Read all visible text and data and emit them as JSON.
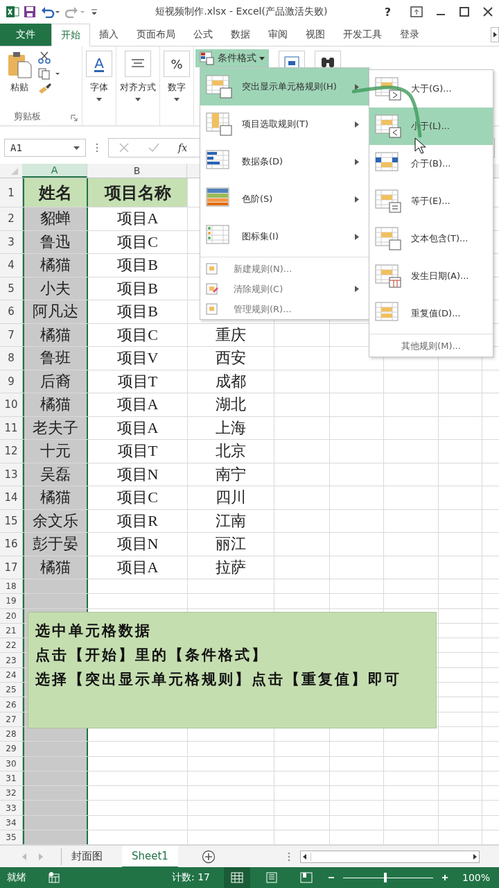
{
  "title_bar": {
    "title": "短视频制作.xlsx - Excel(产品激活失败)",
    "help": "?"
  },
  "file_tab": "文件",
  "ribbon_tabs": [
    {
      "label": "开始",
      "selected": true
    },
    {
      "label": "插入",
      "selected": false
    },
    {
      "label": "页面布局",
      "selected": false
    },
    {
      "label": "公式",
      "selected": false
    },
    {
      "label": "数据",
      "selected": false
    },
    {
      "label": "审阅",
      "selected": false
    },
    {
      "label": "视图",
      "selected": false
    },
    {
      "label": "开发工具",
      "selected": false
    },
    {
      "label": "登录",
      "selected": false
    }
  ],
  "ribbon": {
    "paste": "粘贴",
    "clipboard_group": "剪贴板",
    "buttons": [
      {
        "kind": "font",
        "glyph": "A",
        "label": "字体"
      },
      {
        "kind": "align",
        "label": "对齐方式"
      },
      {
        "kind": "number",
        "glyph": "%",
        "label": "数字"
      }
    ],
    "conditional_format": {
      "label": "条件格式",
      "selected": true
    }
  },
  "formula_bar": {
    "name_box": "A1",
    "fx": "fx"
  },
  "column_headers": [
    {
      "label": "A",
      "selected": true
    },
    {
      "label": "B",
      "selected": false
    }
  ],
  "rows": [
    {
      "num": "1",
      "cells": [
        "姓名",
        "项目名称"
      ]
    },
    {
      "num": "2",
      "cells": [
        "貂蝉",
        "项目A"
      ]
    },
    {
      "num": "3",
      "cells": [
        "鲁迅",
        "项目C"
      ]
    },
    {
      "num": "4",
      "cells": [
        "橘猫",
        "项目B"
      ]
    },
    {
      "num": "5",
      "cells": [
        "小夫",
        "项目B"
      ]
    },
    {
      "num": "6",
      "cells": [
        "阿凡达",
        "项目B"
      ]
    },
    {
      "num": "7",
      "cells": [
        "橘猫",
        "项目C",
        "重庆"
      ]
    },
    {
      "num": "8",
      "cells": [
        "鲁班",
        "项目V",
        "西安"
      ]
    },
    {
      "num": "9",
      "cells": [
        "后裔",
        "项目T",
        "成都"
      ]
    },
    {
      "num": "10",
      "cells": [
        "橘猫",
        "项目A",
        "湖北"
      ]
    },
    {
      "num": "11",
      "cells": [
        "老夫子",
        "项目A",
        "上海"
      ]
    },
    {
      "num": "12",
      "cells": [
        "十元",
        "项目T",
        "北京"
      ]
    },
    {
      "num": "13",
      "cells": [
        "吴磊",
        "项目N",
        "南宁"
      ]
    },
    {
      "num": "14",
      "cells": [
        "橘猫",
        "项目C",
        "四川"
      ]
    },
    {
      "num": "15",
      "cells": [
        "余文乐",
        "项目R",
        "江南"
      ]
    },
    {
      "num": "16",
      "cells": [
        "彭于晏",
        "项目N",
        "丽江"
      ]
    },
    {
      "num": "17",
      "cells": [
        "橘猫",
        "项目A",
        "拉萨"
      ]
    },
    {
      "num": "18",
      "cells": []
    },
    {
      "num": "19",
      "cells": []
    },
    {
      "num": "20",
      "cells": []
    },
    {
      "num": "21",
      "cells": []
    },
    {
      "num": "22",
      "cells": []
    },
    {
      "num": "23",
      "cells": []
    },
    {
      "num": "24",
      "cells": []
    },
    {
      "num": "25",
      "cells": []
    },
    {
      "num": "26",
      "cells": []
    },
    {
      "num": "27",
      "cells": []
    },
    {
      "num": "28",
      "cells": []
    },
    {
      "num": "29",
      "cells": []
    },
    {
      "num": "30",
      "cells": []
    },
    {
      "num": "31",
      "cells": []
    },
    {
      "num": "32",
      "cells": []
    },
    {
      "num": "33",
      "cells": []
    },
    {
      "num": "34",
      "cells": []
    },
    {
      "num": "35",
      "cells": []
    }
  ],
  "note": [
    "选中单元格数据",
    "点击【开始】里的【条件格式】",
    "选择【突出显示单元格规则】点击【重复值】即可"
  ],
  "cf_menu": [
    {
      "kind": "large",
      "label": "突出显示单元格规则(H)",
      "submenu": true,
      "selected": true
    },
    {
      "kind": "large",
      "label": "项目选取规则(T)",
      "submenu": true,
      "selected": false
    },
    {
      "kind": "large",
      "label": "数据条(D)",
      "submenu": true,
      "selected": false
    },
    {
      "kind": "large",
      "label": "色阶(S)",
      "submenu": true,
      "selected": false
    },
    {
      "kind": "large",
      "label": "图标集(I)",
      "submenu": true,
      "selected": false
    },
    {
      "kind": "small",
      "label": "新建规则(N)...",
      "submenu": false,
      "selected": false
    },
    {
      "kind": "small",
      "label": "清除规则(C)",
      "submenu": true,
      "selected": false
    },
    {
      "kind": "small",
      "label": "管理规则(R)...",
      "submenu": false,
      "selected": false
    }
  ],
  "highlight_submenu": [
    {
      "kind": "large",
      "label": "大于(G)...",
      "selected": false
    },
    {
      "kind": "large",
      "label": "小于(L)...",
      "selected": true
    },
    {
      "kind": "large",
      "label": "介于(B)...",
      "selected": false
    },
    {
      "kind": "large",
      "label": "等于(E)...",
      "selected": false
    },
    {
      "kind": "large",
      "label": "文本包含(T)...",
      "selected": false
    },
    {
      "kind": "large",
      "label": "发生日期(A)...",
      "selected": false
    },
    {
      "kind": "large",
      "label": "重复值(D)...",
      "selected": false
    },
    {
      "kind": "plain",
      "label": "其他规则(M)...",
      "selected": false
    }
  ],
  "sheet_tabs": [
    {
      "label": "封面图",
      "selected": false
    },
    {
      "label": "Sheet1",
      "selected": true
    }
  ],
  "status_bar": {
    "status": "就绪",
    "count": "计数: 17",
    "views": [
      {
        "kind": "normal",
        "selected": true
      },
      {
        "kind": "layout",
        "selected": false
      },
      {
        "kind": "break",
        "selected": false
      }
    ],
    "zoom": {
      "level": 0.47,
      "reading": "100%"
    }
  }
}
